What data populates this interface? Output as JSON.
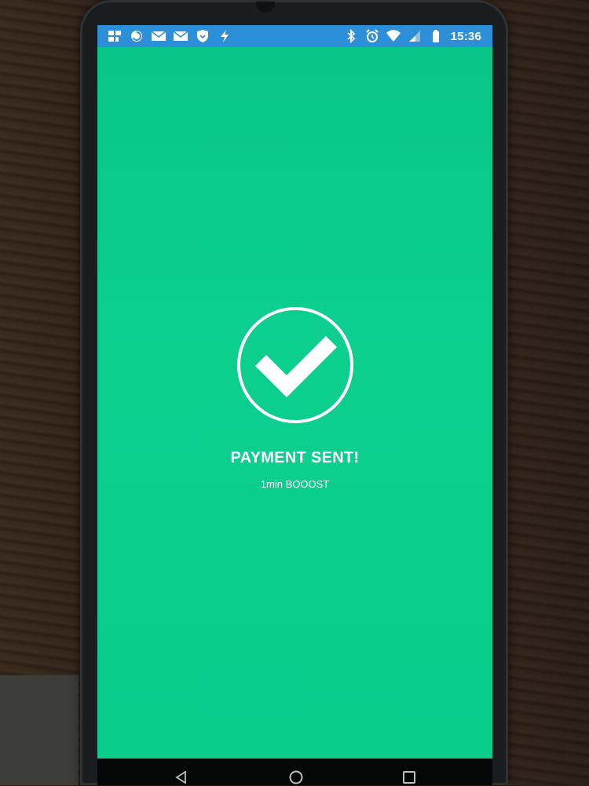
{
  "status_bar": {
    "time": "15:36",
    "left_icons": [
      "app-grid-icon",
      "sync-icon",
      "mail-icon",
      "mail-icon",
      "shield-icon",
      "flash-icon"
    ],
    "right_icons": [
      "bluetooth-icon",
      "alarm-icon",
      "wifi-icon",
      "signal-icon",
      "battery-icon"
    ],
    "color": "#2e8fd9"
  },
  "success": {
    "title": "PAYMENT SENT!",
    "subtitle": "1min BOOOST",
    "icon": "check-circle-icon",
    "background_color": "#0acc8b"
  },
  "navigation": {
    "buttons": [
      "back-icon",
      "home-icon",
      "recent-apps-icon"
    ]
  }
}
